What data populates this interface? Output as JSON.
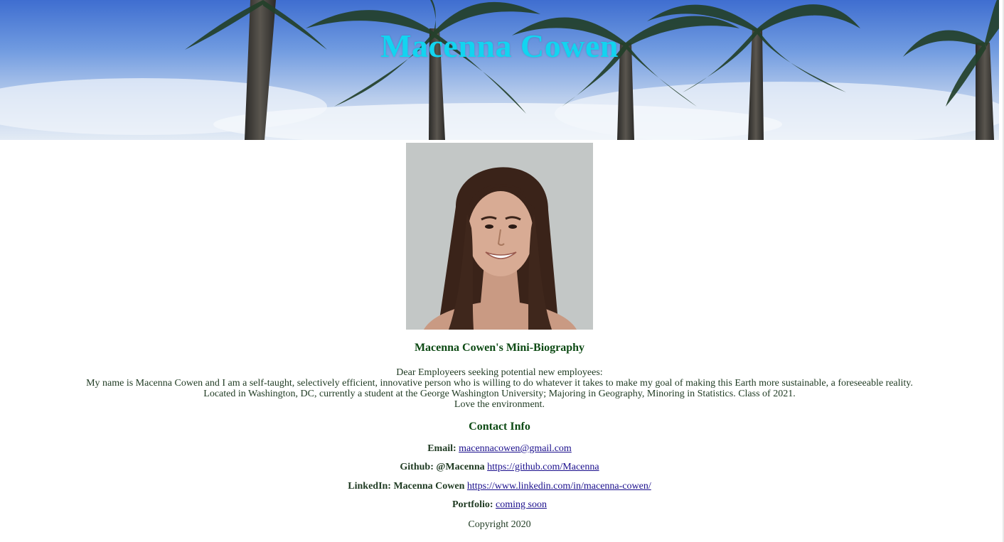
{
  "header": {
    "title": "Macenna Cowen",
    "title_color": "#12d4f0",
    "background": "palm-trees-sky-image"
  },
  "profile": {
    "photo": "profile-photo"
  },
  "biography": {
    "heading": "Macenna Cowen's Mini-Biography",
    "lines": [
      "Dear Employeers seeking potential new employees:",
      "My name is Macenna Cowen and I am a self-taught, selectively efficient, innovative person who is willing to do whatever it takes to make my goal of making this Earth more sustainable, a foreseeable reality.",
      "Located in Washington, DC, currently a student at the George Washington University; Majoring in Geography, Minoring in Statistics. Class of 2021.",
      "Love the environment."
    ]
  },
  "contact": {
    "heading": "Contact Info",
    "email": {
      "label": "Email:",
      "link": "macennacowen@gmail.com"
    },
    "github": {
      "label": "Github: @Macenna",
      "link": "https://github.com/Macenna"
    },
    "linkedin": {
      "label": "LinkedIn: Macenna Cowen",
      "link": "https://www.linkedin.com/in/macenna-cowen/"
    },
    "portfolio": {
      "label": "Portfolio:",
      "link": "coming soon"
    }
  },
  "footer": {
    "copyright": "Copyright 2020"
  },
  "colors": {
    "heading_green": "#0d4a14",
    "link_blue": "#1a0e8c",
    "text": "#1f3a22"
  }
}
